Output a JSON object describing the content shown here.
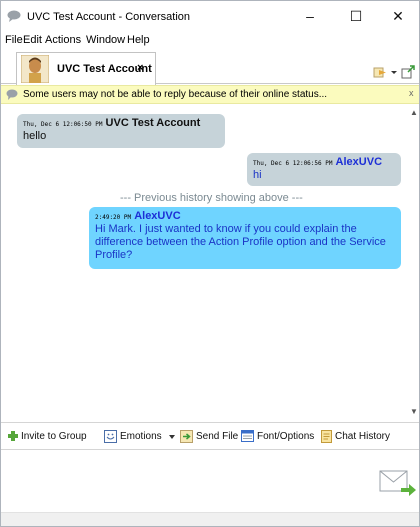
{
  "window": {
    "title": "UVC Test Account - Conversation",
    "controls": {
      "minimize": "–",
      "maximize": "☐",
      "close": "✕"
    }
  },
  "menu": [
    "File",
    "Edit",
    "Actions",
    "Window",
    "Help"
  ],
  "tab": {
    "label": "UVC Test Account",
    "close": "×"
  },
  "notice": {
    "text": "Some users may not be able to reply because of their online status...",
    "close": "x"
  },
  "messages": [
    {
      "time": "Thu, Dec 6 12:06:50 PM",
      "sender": "UVC Test Account",
      "text": "hello"
    },
    {
      "time": "Thu, Dec 6 12:06:56 PM",
      "sender": "AlexUVC",
      "text": "hi"
    },
    {
      "time": "2:49:20 PM",
      "sender": "AlexUVC",
      "text": "Hi Mark. I just wanted to know if you could explain the difference between the Action Profile option and the Service Profile?"
    }
  ],
  "history_separator": "--- Previous history showing above ---",
  "toolbar": {
    "invite": "Invite to Group",
    "emotions": "Emotions",
    "send_file": "Send File",
    "font_options": "Font/Options",
    "chat_history": "Chat History"
  },
  "scroll": {
    "up": "▲",
    "down": "▼"
  },
  "colors": {
    "incoming_bubble": "#c6d3d9",
    "outgoing_bubble": "#6fd4ff",
    "self_name": "#1d2fd6",
    "notice_bg": "#fbfbbe"
  }
}
